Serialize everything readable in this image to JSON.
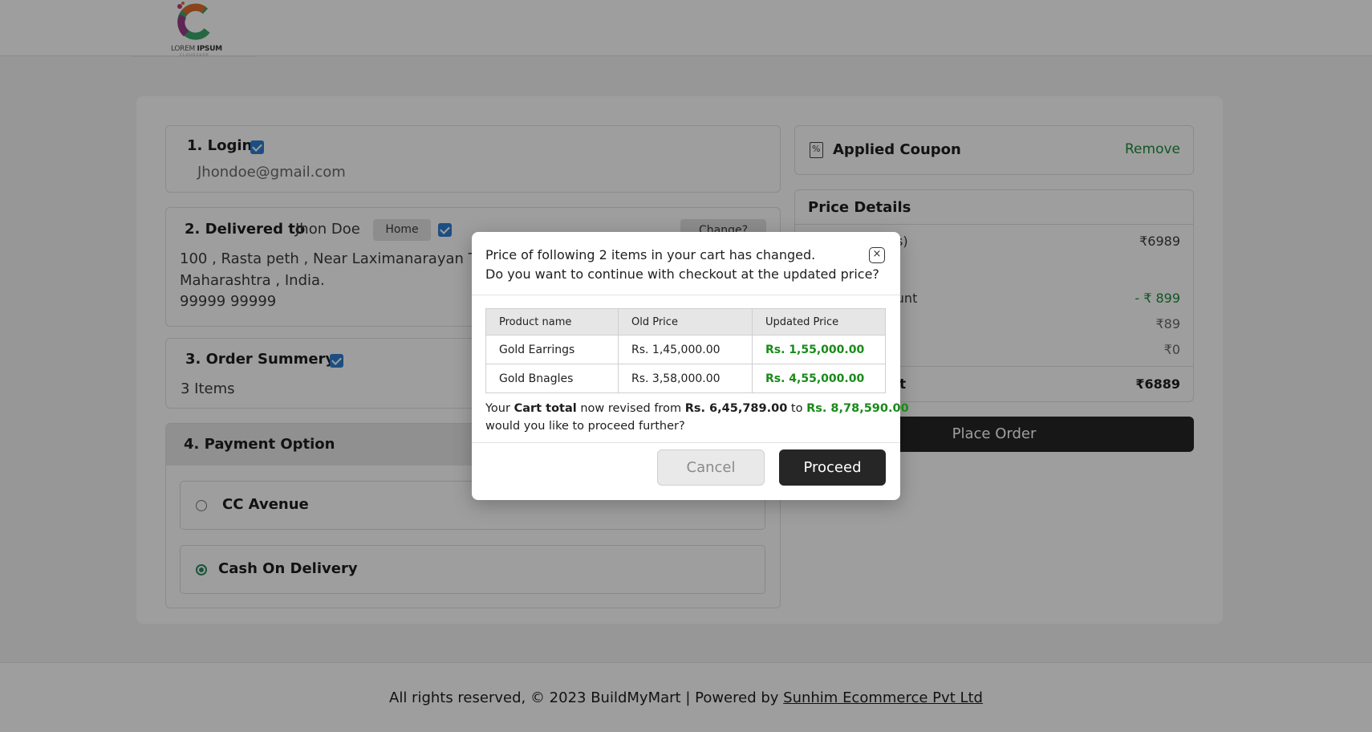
{
  "brand": {
    "logo_text_a": "LOREM ",
    "logo_text_b": "IPSUM",
    "logo_sub": "C L O U D  S H O P"
  },
  "steps": {
    "login": {
      "title": "1. Login",
      "email": "Jhondoe@gmail.com"
    },
    "delivery": {
      "title": "2. Delivered to",
      "name": "Jhon Doe",
      "tag": "Home",
      "change_label": "Change?",
      "address_line1": "100 , Rasta peth , Near Laximanarayan Te",
      "address_line2": "Maharashtra , India.",
      "phone": "99999 99999"
    },
    "summary": {
      "title": "3. Order Summery",
      "items": "3 Items"
    },
    "payment": {
      "title": "4. Payment Option",
      "options": [
        {
          "label": "CC Avenue",
          "selected": false
        },
        {
          "label": "Cash On Delivery",
          "selected": true
        }
      ]
    }
  },
  "coupon": {
    "title": "Applied Coupon",
    "remove_label": "Remove"
  },
  "price_details": {
    "title": "Price Details",
    "rows": [
      {
        "label": "s)",
        "value": "₹6989",
        "color": "#3a3a3a"
      },
      {
        "label": "ount",
        "value": "- ₹ 899",
        "color": "#1f8a3a"
      },
      {
        "label": "",
        "value": "₹89",
        "color": "#6a6a6a"
      },
      {
        "label": "",
        "value": "₹0",
        "color": "#6a6a6a"
      }
    ],
    "total_label": "t",
    "total_value": "₹6889"
  },
  "place_order_label": "Place Order",
  "modal": {
    "line1": "Price of following 2 items in your cart has changed.",
    "line2": "Do you want to continue with checkout at the updated price?",
    "close_glyph": "×",
    "table": {
      "headers": [
        "Product name",
        "Old Price",
        "Updated Price"
      ],
      "rows": [
        [
          "Gold Earrings",
          "Rs. 1,45,000.00",
          "Rs. 1,55,000.00"
        ],
        [
          "Gold Bnagles",
          "Rs. 3,58,000.00",
          "Rs. 4,55,000.00"
        ]
      ]
    },
    "revised": {
      "p1": "Your ",
      "b1": "Cart total",
      "p2": " now revised from ",
      "old_total": "Rs. 6,45,789.00",
      "p3": " to ",
      "new_total": "Rs. 8,78,590.00",
      "line2": "would you like to proceed further?"
    },
    "cancel_label": "Cancel",
    "proceed_label": "Proceed"
  },
  "footer": {
    "text": "All rights reserved, © 2023 BuildMyMart | Powered by ",
    "link": "Sunhim Ecommerce Pvt Ltd"
  },
  "colors": {
    "accent_green": "#1a8a1a",
    "checkbox_blue": "#2f7fd2",
    "dark_button": "#262626"
  }
}
